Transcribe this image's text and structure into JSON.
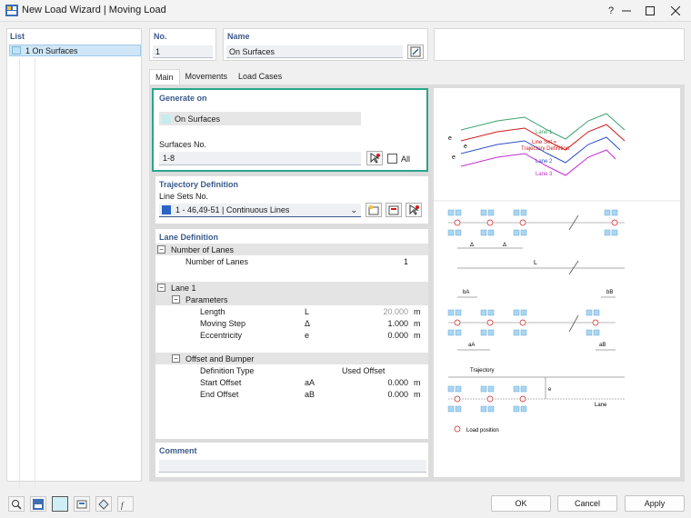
{
  "window": {
    "title": "New Load Wizard | Moving Load",
    "help_icon": "?"
  },
  "list": {
    "title": "List",
    "items": [
      {
        "label": "1  On Surfaces",
        "color": "#bde3f5"
      }
    ]
  },
  "no": {
    "title": "No.",
    "value": "1"
  },
  "name": {
    "title": "Name",
    "value": "On Surfaces"
  },
  "tabs": [
    {
      "label": "Main",
      "active": true
    },
    {
      "label": "Movements",
      "active": false
    },
    {
      "label": "Load Cases",
      "active": false
    }
  ],
  "generate_on": {
    "title": "Generate on",
    "value": "On Surfaces",
    "surfaces_label": "Surfaces No.",
    "surfaces_value": "1-8",
    "all_label": "All",
    "all_checked": false
  },
  "trajectory": {
    "title": "Trajectory Definition",
    "line_sets_label": "Line Sets No.",
    "line_sets_value": "1 - 46,49-51 | Continuous Lines",
    "color": "#2b63c9"
  },
  "lane_definition": {
    "title": "Lane Definition",
    "number_of_lanes_group": "Number of Lanes",
    "number_of_lanes_label": "Number of Lanes",
    "number_of_lanes_value": "1",
    "lane_group": "Lane 1",
    "parameters_group": "Parameters",
    "length_label": "Length",
    "length_symbol": "L",
    "length_value": "20.000",
    "length_unit": "m",
    "step_label": "Moving Step",
    "step_symbol": "Δ",
    "step_value": "1.000",
    "step_unit": "m",
    "ecc_label": "Eccentricity",
    "ecc_symbol": "e",
    "ecc_value": "0.000",
    "ecc_unit": "m",
    "offset_group": "Offset and Bumper",
    "def_type_label": "Definition Type",
    "def_type_value": "Used Offset",
    "start_label": "Start Offset",
    "start_symbol": "aA",
    "start_value": "0.000",
    "start_unit": "m",
    "end_label": "End Offset",
    "end_symbol": "aB",
    "end_value": "0.000",
    "end_unit": "m"
  },
  "comment": {
    "title": "Comment",
    "value": ""
  },
  "diagram": {
    "lane1": "Lane 1",
    "lineset": "Line Set =",
    "trajdef": "Trajectory Definition",
    "lane2": "Lane 2",
    "lane3": "Lane 3",
    "e1": "e",
    "e2": "e",
    "e3": "e",
    "delta1": "Δ",
    "delta2": "Δ",
    "L": "L",
    "bA": "bA",
    "bB": "bB",
    "aA": "aA",
    "aB": "aB",
    "trajectory": "Trajectory",
    "lane": "Lane",
    "load_position": "Load position"
  },
  "buttons": {
    "ok": "OK",
    "cancel": "Cancel",
    "apply": "Apply"
  }
}
